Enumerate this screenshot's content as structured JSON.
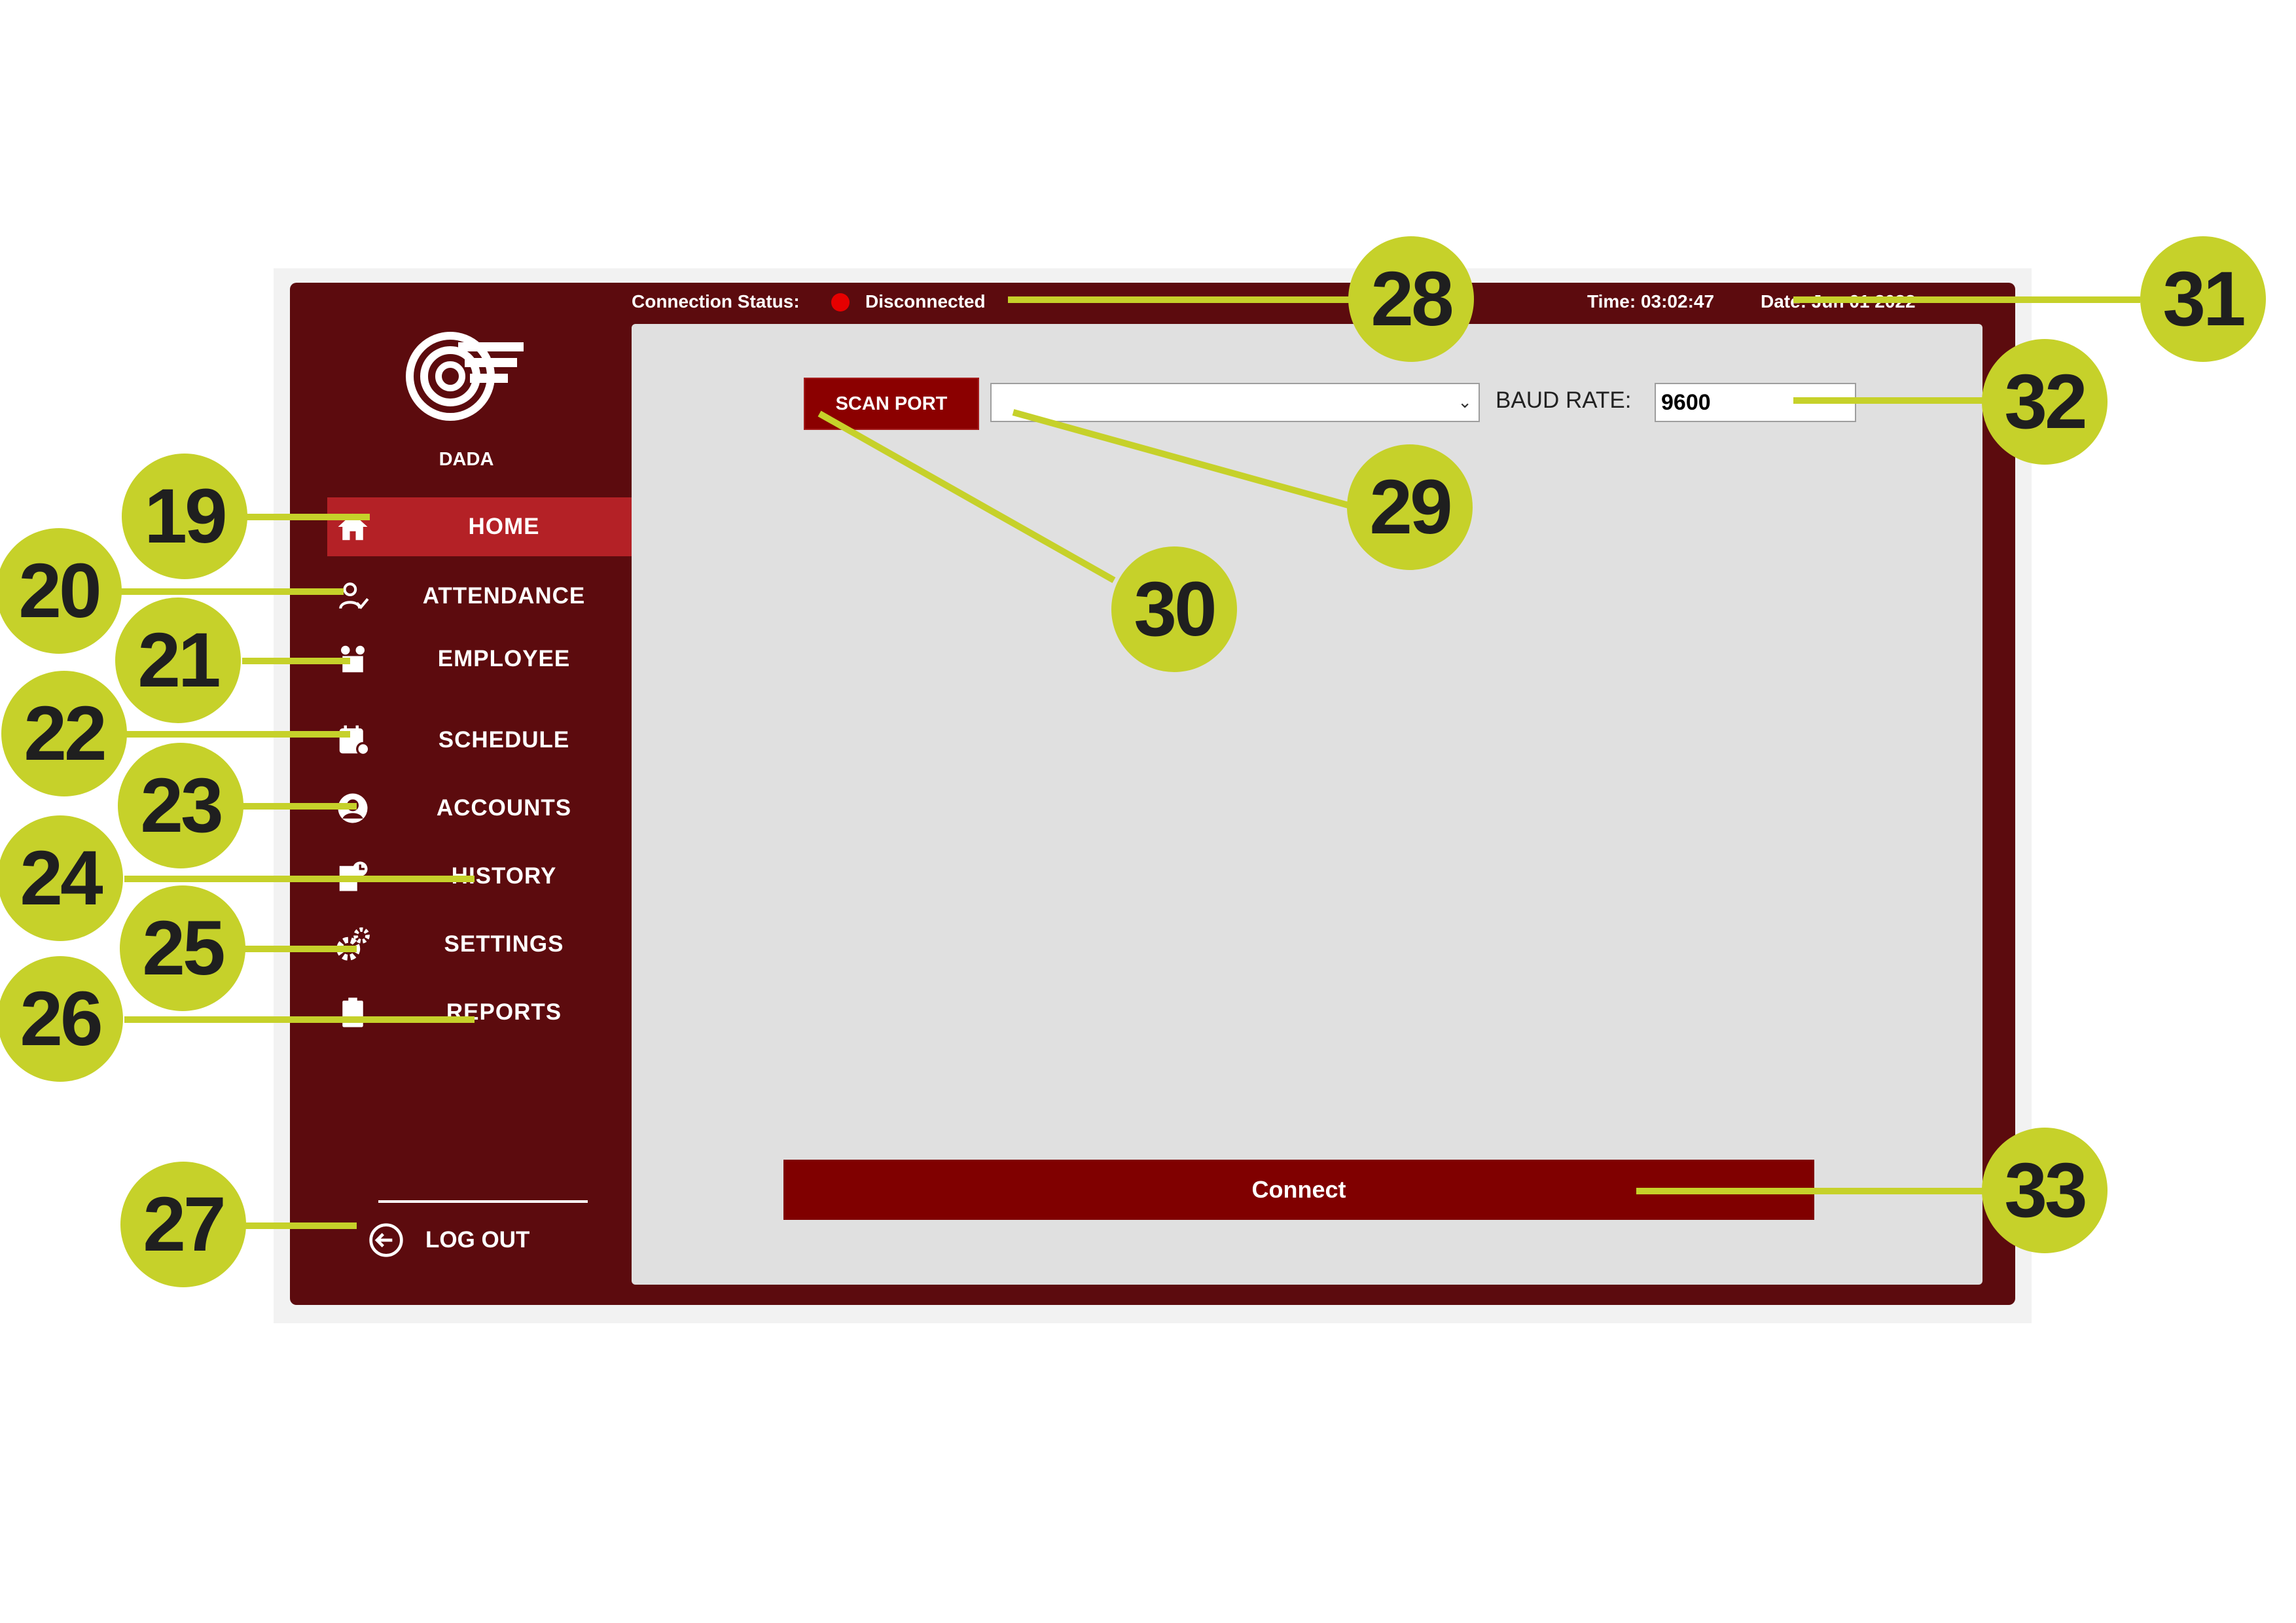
{
  "app": {
    "brand_name": "DADA",
    "colors": {
      "window": "#5c0b0e",
      "active_nav": "#b42126",
      "button": "#800000",
      "content_bg": "#e0e0e0",
      "status_disconnected": "#e60000",
      "callout": "#c6d12a"
    }
  },
  "topbar": {
    "connection_status_label": "Connection Status:",
    "connection_status_value": "Disconnected",
    "time_text": "Time: 03:02:47",
    "date_text": "Date: Jun 01 2022"
  },
  "sidebar": {
    "items": [
      {
        "label": "HOME",
        "icon": "home-icon",
        "active": true
      },
      {
        "label": "ATTENDANCE",
        "icon": "attendance-icon",
        "active": false
      },
      {
        "label": "EMPLOYEE",
        "icon": "employee-icon",
        "active": false
      },
      {
        "label": "SCHEDULE",
        "icon": "calendar-icon",
        "active": false
      },
      {
        "label": "ACCOUNTS",
        "icon": "account-icon",
        "active": false
      },
      {
        "label": "HISTORY",
        "icon": "history-icon",
        "active": false
      },
      {
        "label": "SETTINGS",
        "icon": "gear-icon",
        "active": false
      },
      {
        "label": "REPORTS",
        "icon": "clipboard-icon",
        "active": false
      }
    ],
    "logout_label": "LOG OUT"
  },
  "main": {
    "scan_port_label": "SCAN PORT",
    "port_select_value": "",
    "baud_rate_label": "BAUD RATE:",
    "baud_rate_value": "9600",
    "connect_label": "Connect"
  },
  "callouts": [
    "19",
    "20",
    "21",
    "22",
    "23",
    "24",
    "25",
    "26",
    "27",
    "28",
    "29",
    "30",
    "31",
    "32",
    "33"
  ]
}
